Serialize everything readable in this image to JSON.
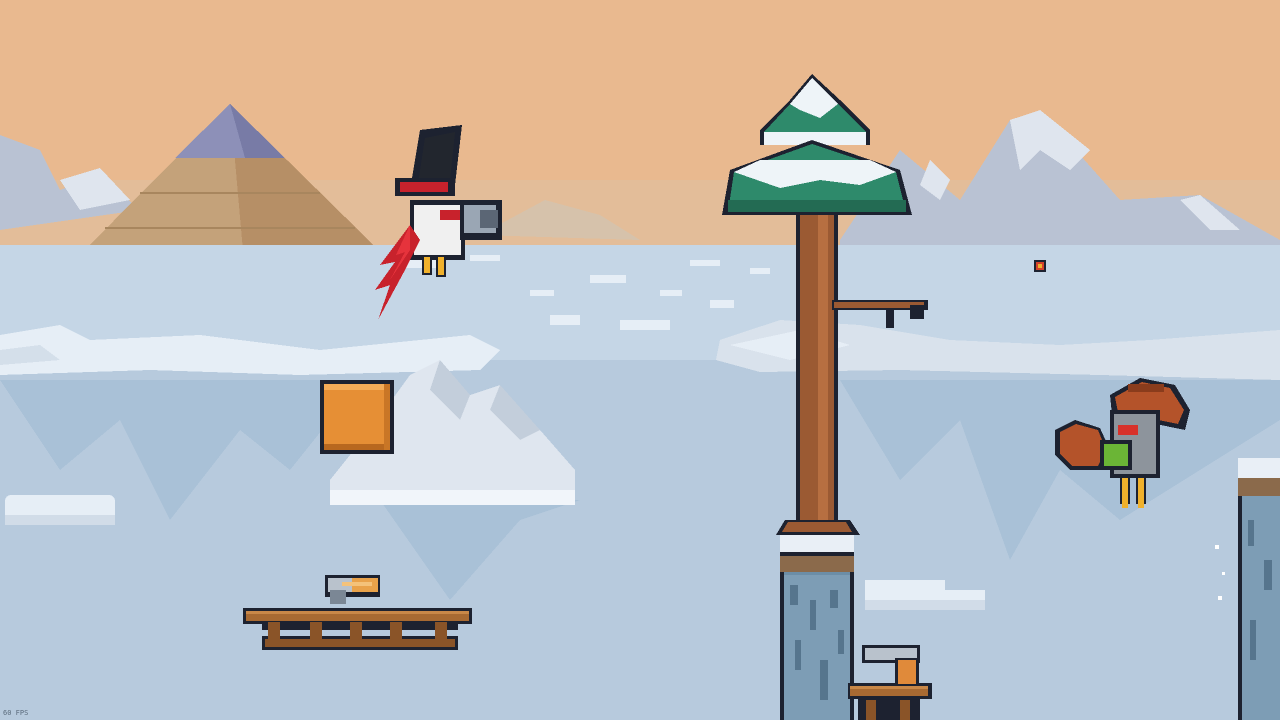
{
  "hud": {
    "fps_label": "60 FPS"
  },
  "scene": {
    "name": "snowy-lake-arena",
    "palette": {
      "sky": "#e9b98f",
      "sky_low": "#e3bd99",
      "mountain": "#b9c2d3",
      "mountain_snow": "#dfe5ee",
      "pyramid": "#c4a27a",
      "pyramid_cap": "#8d90b8",
      "water": "#c5d6e6",
      "water_deep": "#a9c1d7",
      "ice": "#e6eef6",
      "tree_foliage": "#2e8a6b",
      "tree_trunk": "#9b5a33",
      "block": "#e68f35",
      "wood": "#a86a32",
      "stone": "#6c8ea7"
    },
    "objects": [
      "pyramid",
      "pine-tree",
      "item-block",
      "wooden-bench-left",
      "wooden-bench-right",
      "stone-pillar-center",
      "stone-pillar-right",
      "duck-red-bandana",
      "duck-cowboy-hat",
      "pistol-pickup-left",
      "pistol-pickup-right",
      "bullet-projectile"
    ]
  }
}
